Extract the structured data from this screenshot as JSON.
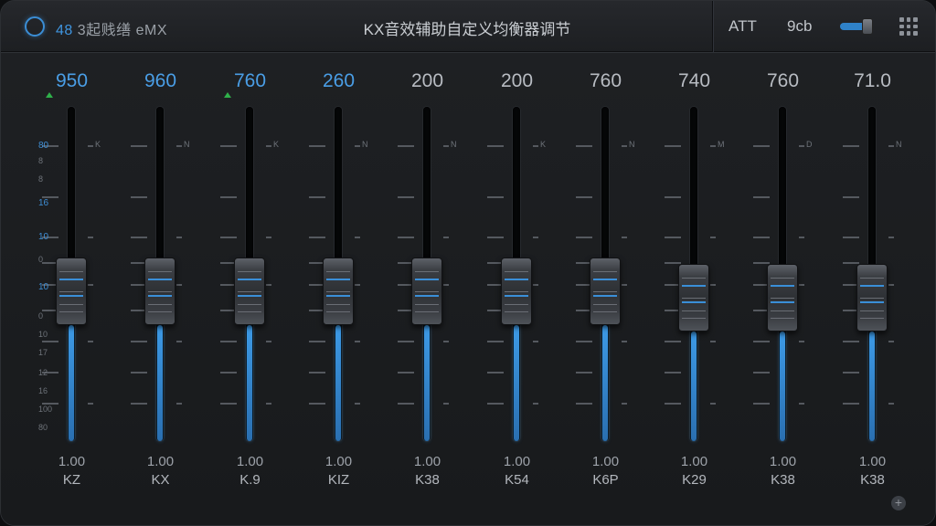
{
  "header": {
    "brand_left": "48",
    "brand_right": "3起贱缮 eMX",
    "title": "KX音效辅助自定义均衡器调节",
    "att_label": "ATT",
    "gain_label": "9cb"
  },
  "colors": {
    "accent": "#3f95e0",
    "indicator": "#2fb04a"
  },
  "icons": {
    "power": "power-ring-icon",
    "menu": "grid-icon",
    "add": "add-icon"
  },
  "channels": [
    {
      "value": "950",
      "blue": true,
      "gain": "1.00",
      "name": "KZ",
      "level": 0.55,
      "marker": true
    },
    {
      "value": "960",
      "blue": true,
      "gain": "1.00",
      "name": "KX",
      "level": 0.55,
      "marker": false
    },
    {
      "value": "760",
      "blue": true,
      "gain": "1.00",
      "name": "K.9",
      "level": 0.55,
      "marker": true
    },
    {
      "value": "260",
      "blue": true,
      "gain": "1.00",
      "name": "KIZ",
      "level": 0.55,
      "marker": false
    },
    {
      "value": "200",
      "blue": false,
      "gain": "1.00",
      "name": "K38",
      "level": 0.55,
      "marker": false
    },
    {
      "value": "200",
      "blue": false,
      "gain": "1.00",
      "name": "K54",
      "level": 0.55,
      "marker": false
    },
    {
      "value": "760",
      "blue": false,
      "gain": "1.00",
      "name": "K6P",
      "level": 0.55,
      "marker": false
    },
    {
      "value": "740",
      "blue": false,
      "gain": "1.00",
      "name": "K29",
      "level": 0.53,
      "marker": false
    },
    {
      "value": "760",
      "blue": false,
      "gain": "1.00",
      "name": "K38",
      "level": 0.53,
      "marker": false
    },
    {
      "value": "71.0",
      "blue": false,
      "gain": "1.00",
      "name": "K38",
      "level": 0.53,
      "marker": false
    }
  ],
  "scale_left": [
    "80",
    "8",
    "8",
    "16",
    "10",
    "0",
    "10",
    "0",
    "10",
    "17",
    "12",
    "16",
    "100",
    "80"
  ],
  "scale_right": [
    "K",
    "N",
    "K",
    "N",
    "N",
    "K",
    "N",
    "M",
    "D",
    "N"
  ]
}
